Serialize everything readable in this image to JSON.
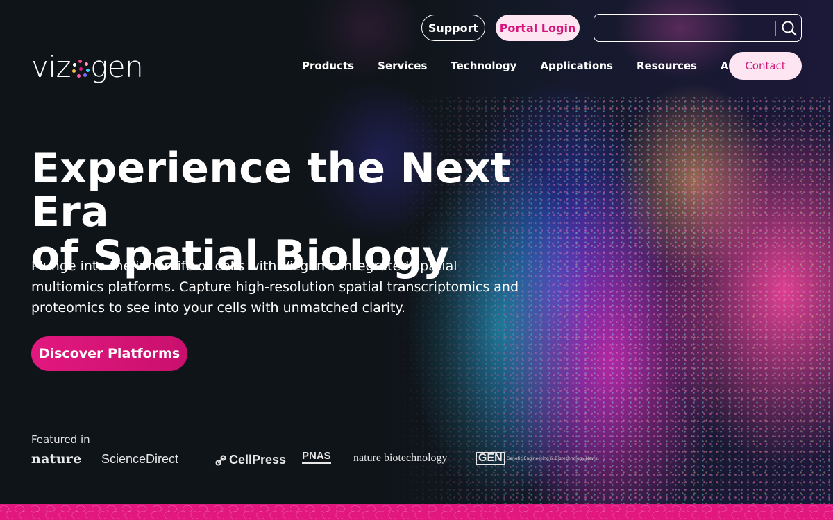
{
  "header": {
    "logo_text": "vizgen",
    "utility": {
      "support_label": "Support",
      "portal_login_label": "Portal Login",
      "search_placeholder": ""
    },
    "nav": [
      {
        "label": "Products"
      },
      {
        "label": "Services"
      },
      {
        "label": "Technology"
      },
      {
        "label": "Applications"
      },
      {
        "label": "Resources"
      },
      {
        "label": "About Us"
      }
    ],
    "contact_label": "Contact"
  },
  "hero": {
    "title_line1": "Experience the Next Era",
    "title_line2": "of Spatial Biology",
    "description": "Plunge into the inner life of cells with Vizgen’s integrated spatial multiomics platforms. Capture high-resolution spatial transcriptomics and proteomics to see into your cells with unmatched clarity.",
    "cta_label": "Discover Platforms"
  },
  "featured": {
    "label": "Featured in",
    "publications": {
      "nature": "nature",
      "sciencedirect": "ScienceDirect",
      "cellpress": "CellPress",
      "pnas": "PNAS",
      "nature_biotech": "nature biotechnology",
      "gen": "GEN",
      "gen_sub": "Genetic Engineering & Biotechnology News"
    }
  },
  "colors": {
    "accent_pink": "#e2187f",
    "light_pink": "#fde6f2",
    "background": "#0f1419"
  },
  "icons": {
    "search": "search-icon"
  }
}
